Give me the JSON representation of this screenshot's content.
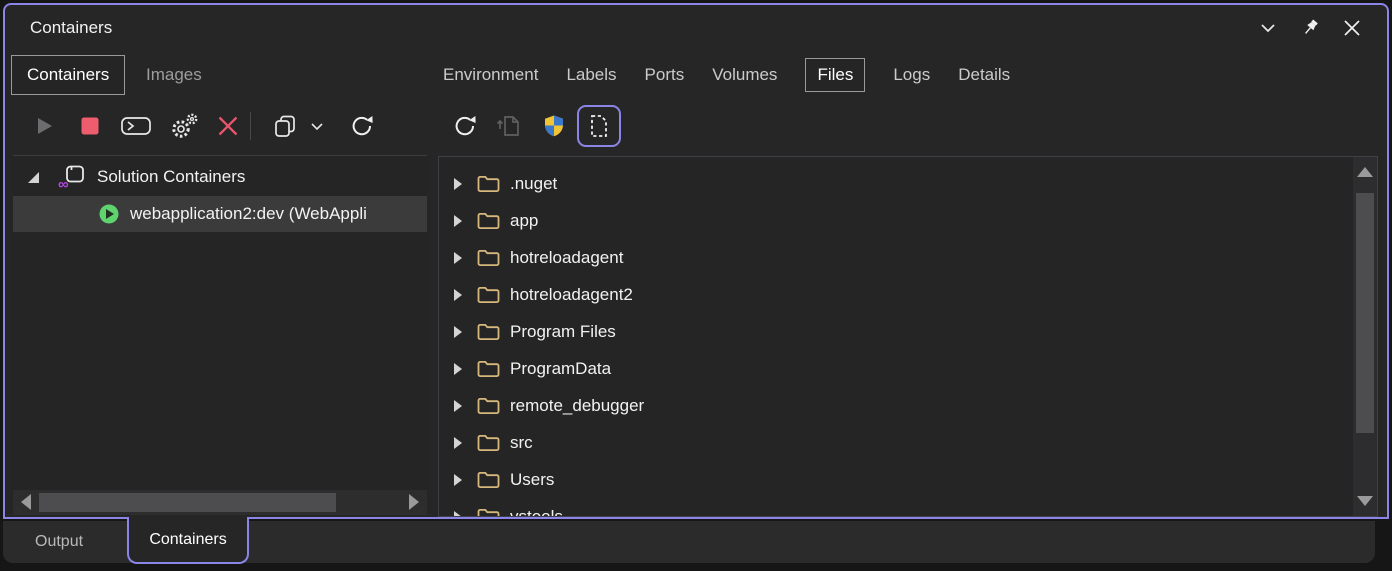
{
  "window": {
    "title": "Containers"
  },
  "titlebar": {
    "icons": [
      "chevron-down",
      "pin",
      "close"
    ]
  },
  "left_panel": {
    "tabs": [
      {
        "label": "Containers"
      },
      {
        "label": "Images"
      }
    ],
    "active_tab": "Containers",
    "toolbar_icons": [
      "start",
      "stop",
      "attach-terminal",
      "settings-gears",
      "remove",
      "copy",
      "copy-dropdown",
      "refresh"
    ],
    "tree": {
      "root": {
        "label": "Solution Containers",
        "expanded": true
      },
      "child": {
        "label": "webapplication2:dev (WebAppli",
        "selected": true,
        "state": "running"
      }
    }
  },
  "right_panel": {
    "tabs": [
      {
        "label": "Environment"
      },
      {
        "label": "Labels"
      },
      {
        "label": "Ports"
      },
      {
        "label": "Volumes"
      },
      {
        "label": "Files"
      },
      {
        "label": "Logs"
      },
      {
        "label": "Details"
      }
    ],
    "active_tab": "Files",
    "toolbar_icons": [
      "refresh",
      "export-file",
      "elevate-shield",
      "view-file-contents"
    ],
    "files": [
      {
        "name": ".nuget"
      },
      {
        "name": "app"
      },
      {
        "name": "hotreloadagent"
      },
      {
        "name": "hotreloadagent2"
      },
      {
        "name": "Program Files"
      },
      {
        "name": "ProgramData"
      },
      {
        "name": "remote_debugger"
      },
      {
        "name": "src"
      },
      {
        "name": "Users"
      },
      {
        "name": "vstools"
      }
    ]
  },
  "bottom_tabs": [
    {
      "label": "Output"
    },
    {
      "label": "Containers"
    }
  ],
  "colors": {
    "accent_purple": "#8a85e6",
    "stop_red": "#ee5d6d",
    "delete_red": "#e8556d",
    "run_green": "#5fd36e",
    "folder_tan": "#d7b87c",
    "vs_logo_purple": "#b14ae3",
    "shield_blue": "#3a78c9",
    "shield_yellow": "#f1c336"
  }
}
